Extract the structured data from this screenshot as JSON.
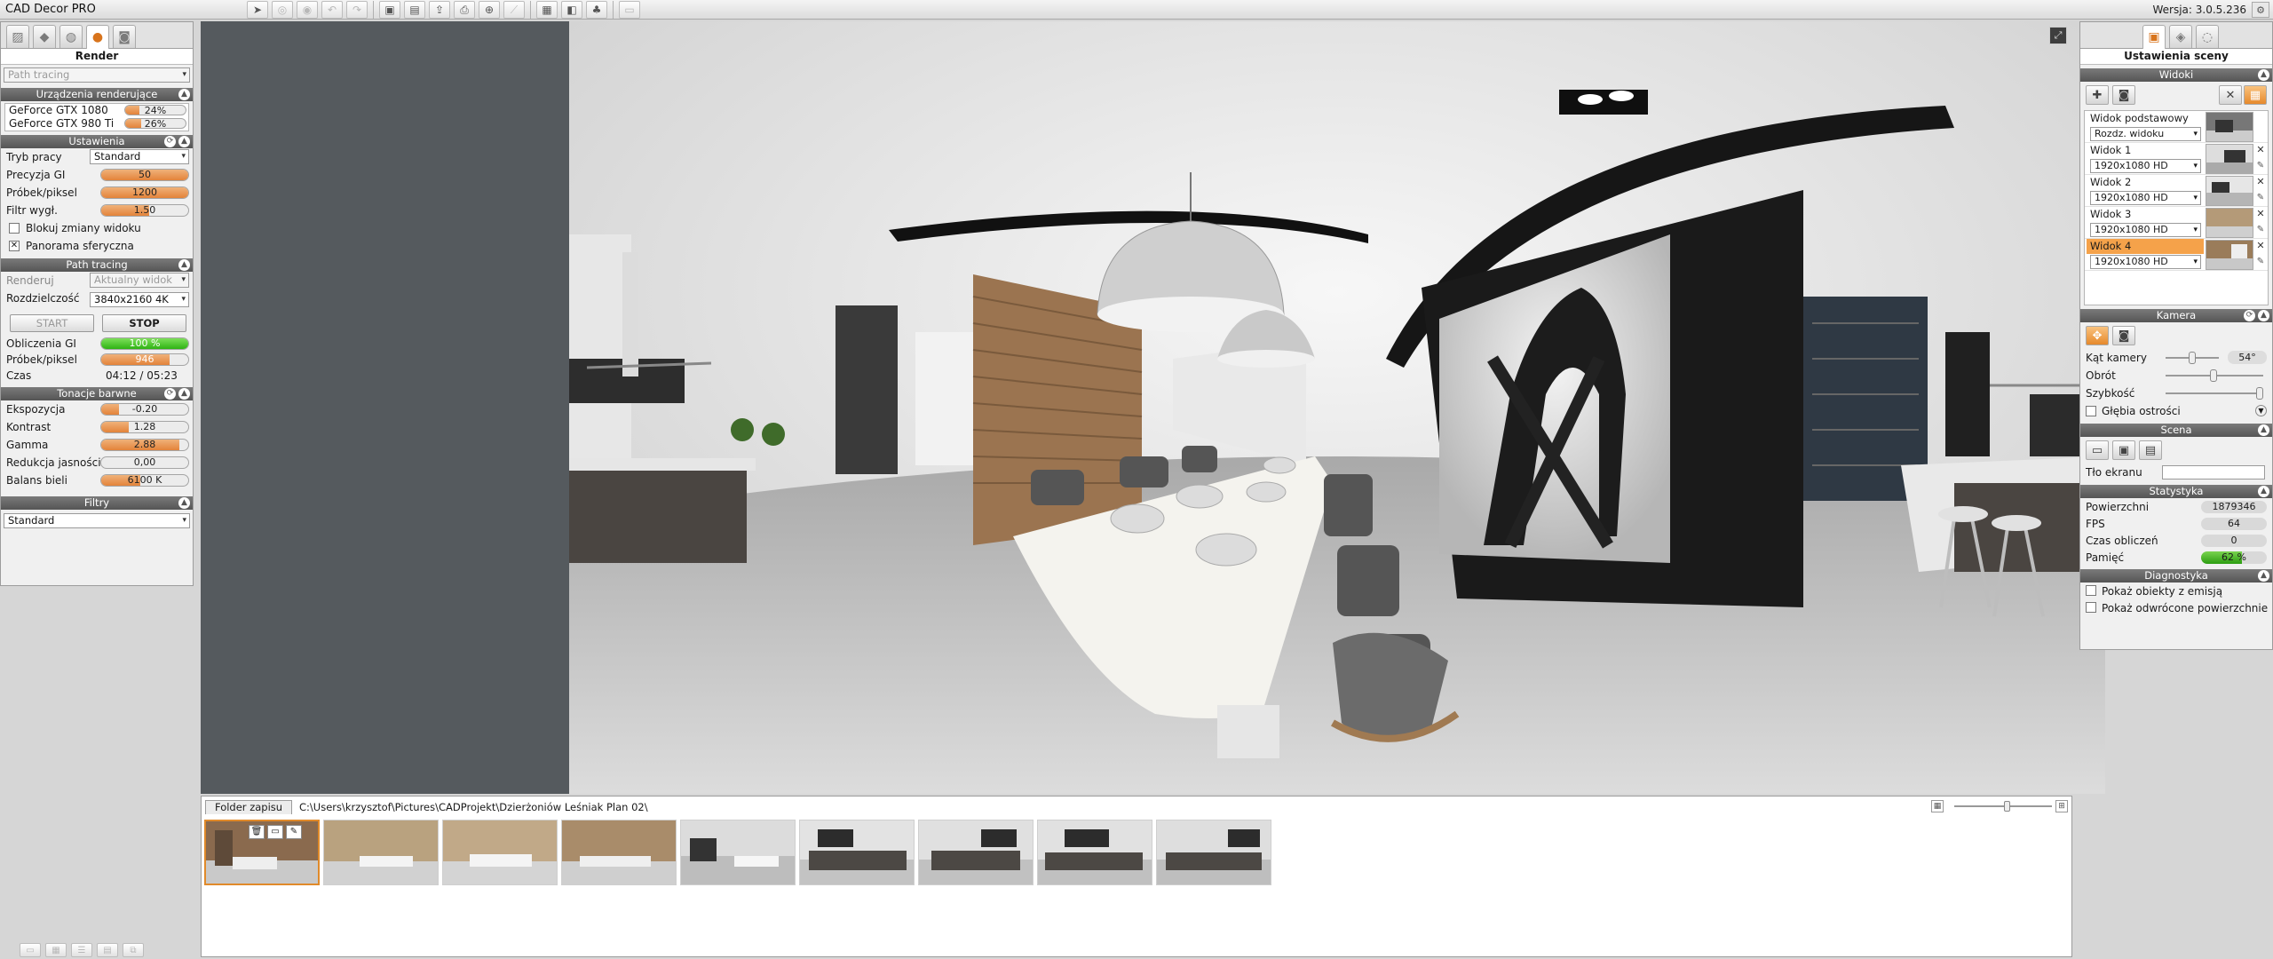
{
  "app": {
    "title": "CAD Decor PRO",
    "version": "Wersja: 3.0.5.236"
  },
  "left": {
    "title": "Render",
    "mode_select": "Path tracing",
    "devices": {
      "header": "Urządzenia renderujące",
      "items": [
        {
          "name": "GeForce GTX 1080",
          "usage": "24%",
          "fraction": 0.24
        },
        {
          "name": "GeForce GTX 980 Ti",
          "usage": "26%",
          "fraction": 0.26
        }
      ]
    },
    "settings": {
      "header": "Ustawienia",
      "work_mode_label": "Tryb pracy",
      "work_mode": "Standard",
      "gi_precision_label": "Precyzja GI",
      "gi_precision": "50",
      "samples_label": "Próbek/piksel",
      "samples": "1200",
      "filter_label": "Filtr wygł.",
      "filter": "1.50",
      "lock_view_label": "Blokuj zmiany widoku",
      "panorama_label": "Panorama sferyczna"
    },
    "path_tracing": {
      "header": "Path tracing",
      "render_label": "Renderuj",
      "render_value": "Aktualny widok",
      "resolution_label": "Rozdzielczość",
      "resolution_value": "3840x2160 4K",
      "start": "START",
      "stop": "STOP",
      "gi_calc_label": "Obliczenia GI",
      "gi_calc_value": "100 %",
      "gi_calc_fraction": 1.0,
      "samples_label": "Próbek/piksel",
      "samples_value": "946",
      "time_label": "Czas",
      "time_value": "04:12 / 05:23"
    },
    "tones": {
      "header": "Tonacje barwne",
      "exposure_label": "Ekspozycja",
      "exposure": "-0.20",
      "contrast_label": "Kontrast",
      "contrast": "1.28",
      "gamma_label": "Gamma",
      "gamma": "2.88",
      "brightness_label": "Redukcja jasności",
      "brightness": "0,00",
      "white_label": "Balans bieli",
      "white": "6100 K"
    },
    "filters": {
      "header": "Filtry",
      "value": "Standard"
    }
  },
  "browser": {
    "tab": "Folder zapisu",
    "path": "C:\\Users\\krzysztof\\Pictures\\CADProjekt\\Dzierżoniów Leśniak Plan 02\\"
  },
  "right": {
    "title": "Ustawienia sceny",
    "views": {
      "header": "Widoki",
      "items": [
        {
          "name": "Widok podstawowy",
          "res": "Rozdz. widoku"
        },
        {
          "name": "Widok 1",
          "res": "1920x1080 HD"
        },
        {
          "name": "Widok 2",
          "res": "1920x1080 HD"
        },
        {
          "name": "Widok 3",
          "res": "1920x1080 HD"
        },
        {
          "name": "Widok 4",
          "res": "1920x1080 HD"
        }
      ]
    },
    "camera": {
      "header": "Kamera",
      "angle_label": "Kąt kamery",
      "angle_value": "54°",
      "rotation_label": "Obrót",
      "speed_label": "Szybkość",
      "dof_label": "Głębia ostrości"
    },
    "scene": {
      "header": "Scena",
      "bg_label": "Tło ekranu"
    },
    "stats": {
      "header": "Statystyka",
      "surfaces_label": "Powierzchni",
      "surfaces": "1879346",
      "fps_label": "FPS",
      "fps": "64",
      "calc_label": "Czas obliczeń",
      "calc": "0",
      "memory_label": "Pamięć",
      "memory": "62 %",
      "memory_fraction": 0.62
    },
    "diag": {
      "header": "Diagnostyka",
      "emissive_label": "Pokaż obiekty z emisją",
      "reversed_label": "Pokaż odwrócone powierzchnie"
    }
  },
  "colors": {
    "accent": "#e8842c",
    "progress_green": "#2fb314"
  }
}
